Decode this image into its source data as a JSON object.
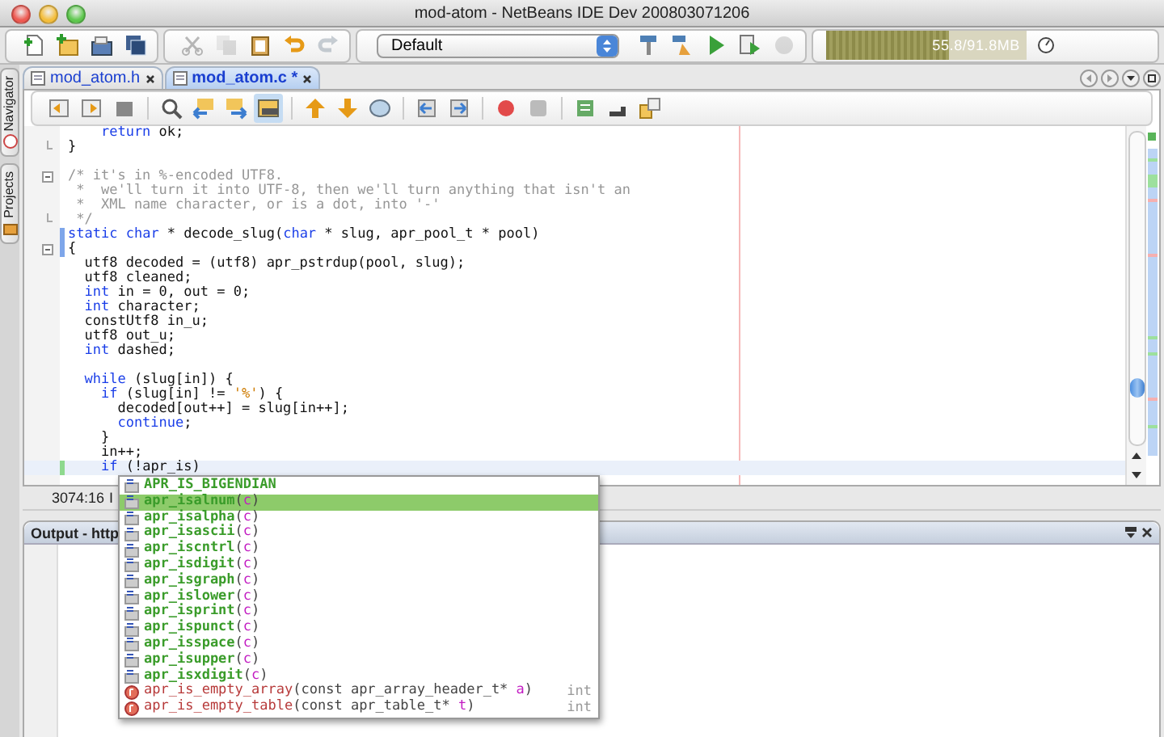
{
  "window": {
    "title": "mod-atom - NetBeans IDE Dev 200803071206"
  },
  "main_toolbar": {
    "file_buttons": [
      {
        "disabled": false
      },
      {
        "disabled": false
      },
      {
        "disabled": false
      },
      {
        "disabled": false
      }
    ],
    "edit_buttons": [
      {
        "disabled": true
      },
      {
        "disabled": true
      },
      {
        "disabled": false
      },
      {
        "disabled": false
      },
      {
        "disabled": true
      }
    ],
    "configuration": "Default",
    "run_buttons": [
      {
        "disabled": false
      },
      {
        "disabled": false
      },
      {
        "disabled": false
      },
      {
        "disabled": false
      },
      {
        "disabled": true
      }
    ],
    "memory": {
      "reading": "55.8/91.8MB",
      "level": 0.61
    }
  },
  "side_tabs": [
    {
      "label": "Navigator"
    },
    {
      "label": "Projects"
    }
  ],
  "editor_tabs": [
    {
      "label": "mod_atom.h",
      "selected": false
    },
    {
      "label": "mod_atom.c *",
      "selected": true
    }
  ],
  "editor_toolbar": [
    {
      "pressed": false
    },
    {
      "pressed": false
    },
    {
      "pressed": false
    },
    {
      "pressed": false
    },
    {
      "pressed": false
    },
    {
      "pressed": false
    },
    {
      "pressed": true
    },
    {
      "pressed": false
    },
    {
      "pressed": false
    },
    {
      "pressed": false
    },
    {
      "pressed": false
    },
    {
      "pressed": false
    },
    {
      "pressed": false
    },
    {
      "pressed": false
    },
    {
      "pressed": false
    },
    {
      "pressed": false
    },
    {
      "pressed": false
    }
  ],
  "code_lines": [
    {
      "segments": [
        {
          "text": "    return",
          "kind": "keyword"
        },
        {
          "text": " ok;",
          "kind": "plain"
        }
      ],
      "fold_start": false,
      "fold_end": false,
      "modified": false,
      "added": false,
      "current": false
    },
    {
      "segments": [
        {
          "text": "}",
          "kind": "plain"
        }
      ],
      "fold_start": false,
      "fold_end": true,
      "modified": false,
      "added": false,
      "current": false
    },
    {
      "fold_start": false,
      "fold_end": false,
      "modified": false,
      "added": false,
      "current": false
    },
    {
      "segments": [
        {
          "text": "/* it's in %-encoded UTF8.",
          "kind": "comment"
        }
      ],
      "fold_start": true,
      "fold_end": false,
      "modified": false,
      "added": false,
      "current": false
    },
    {
      "segments": [
        {
          "text": " *  we'll turn it into UTF-8, then we'll turn anything that isn't an",
          "kind": "comment"
        }
      ],
      "fold_start": false,
      "fold_end": false,
      "modified": false,
      "added": false,
      "current": false
    },
    {
      "segments": [
        {
          "text": " *  XML name character, or is a dot, into '-'",
          "kind": "comment"
        }
      ],
      "fold_start": false,
      "fold_end": false,
      "modified": false,
      "added": false,
      "current": false
    },
    {
      "segments": [
        {
          "text": " */",
          "kind": "comment"
        }
      ],
      "fold_start": false,
      "fold_end": true,
      "modified": false,
      "added": false,
      "current": false
    },
    {
      "segments": [
        {
          "text": "static",
          "kind": "keyword"
        },
        {
          "text": " char",
          "kind": "keyword"
        },
        {
          "text": " * decode_slug(",
          "kind": "plain"
        },
        {
          "text": "char",
          "kind": "keyword"
        },
        {
          "text": " * slug, apr_pool_t * pool)",
          "kind": "plain"
        }
      ],
      "fold_start": false,
      "fold_end": false,
      "modified": true,
      "added": false,
      "current": false
    },
    {
      "segments": [
        {
          "text": "{",
          "kind": "plain"
        }
      ],
      "fold_start": true,
      "fold_end": false,
      "modified": true,
      "added": false,
      "current": false
    },
    {
      "segments": [
        {
          "text": "  utf8 decoded = (utf8) apr_pstrdup(pool, slug);",
          "kind": "plain"
        }
      ],
      "fold_start": false,
      "fold_end": false,
      "modified": false,
      "added": false,
      "current": false
    },
    {
      "segments": [
        {
          "text": "  utf8 cleaned;",
          "kind": "plain"
        }
      ],
      "fold_start": false,
      "fold_end": false,
      "modified": false,
      "added": false,
      "current": false
    },
    {
      "segments": [
        {
          "text": "  int",
          "kind": "keyword"
        },
        {
          "text": " in = 0, out = 0;",
          "kind": "plain"
        }
      ],
      "fold_start": false,
      "fold_end": false,
      "modified": false,
      "added": false,
      "current": false
    },
    {
      "segments": [
        {
          "text": "  int",
          "kind": "keyword"
        },
        {
          "text": " character;",
          "kind": "plain"
        }
      ],
      "fold_start": false,
      "fold_end": false,
      "modified": false,
      "added": false,
      "current": false
    },
    {
      "segments": [
        {
          "text": "  constUtf8 in_u;",
          "kind": "plain"
        }
      ],
      "fold_start": false,
      "fold_end": false,
      "modified": false,
      "added": false,
      "current": false
    },
    {
      "segments": [
        {
          "text": "  utf8 out_u;",
          "kind": "plain"
        }
      ],
      "fold_start": false,
      "fold_end": false,
      "modified": false,
      "added": false,
      "current": false
    },
    {
      "segments": [
        {
          "text": "  int",
          "kind": "keyword"
        },
        {
          "text": " dashed;",
          "kind": "plain"
        }
      ],
      "fold_start": false,
      "fold_end": false,
      "modified": false,
      "added": false,
      "current": false
    },
    {
      "fold_start": false,
      "fold_end": false,
      "modified": false,
      "added": false,
      "current": false
    },
    {
      "segments": [
        {
          "text": "  while",
          "kind": "keyword"
        },
        {
          "text": " (slug[in]) {",
          "kind": "plain"
        }
      ],
      "fold_start": false,
      "fold_end": false,
      "modified": false,
      "added": false,
      "current": false
    },
    {
      "segments": [
        {
          "text": "    if",
          "kind": "keyword"
        },
        {
          "text": " (slug[in] != ",
          "kind": "plain"
        },
        {
          "text": "'%'",
          "kind": "string"
        },
        {
          "text": ") {",
          "kind": "plain"
        }
      ],
      "fold_start": false,
      "fold_end": false,
      "modified": false,
      "added": false,
      "current": false
    },
    {
      "segments": [
        {
          "text": "      decoded[out++] = slug[in++];",
          "kind": "plain"
        }
      ],
      "fold_start": false,
      "fold_end": false,
      "modified": false,
      "added": false,
      "current": false
    },
    {
      "segments": [
        {
          "text": "      continue",
          "kind": "keyword"
        },
        {
          "text": ";",
          "kind": "plain"
        }
      ],
      "fold_start": false,
      "fold_end": false,
      "modified": false,
      "added": false,
      "current": false
    },
    {
      "segments": [
        {
          "text": "    }",
          "kind": "plain"
        }
      ],
      "fold_start": false,
      "fold_end": false,
      "modified": false,
      "added": false,
      "current": false
    },
    {
      "segments": [
        {
          "text": "    in++;",
          "kind": "plain"
        }
      ],
      "fold_start": false,
      "fold_end": false,
      "modified": false,
      "added": false,
      "current": false
    },
    {
      "segments": [
        {
          "text": "    if",
          "kind": "keyword"
        },
        {
          "text": " (!apr_is)",
          "kind": "plain"
        }
      ],
      "fold_start": false,
      "fold_end": false,
      "modified": false,
      "added": true,
      "current": true
    }
  ],
  "status_bar": {
    "position": "3074:16",
    "mode": "I"
  },
  "output": {
    "title": "Output - http"
  },
  "completion": [
    {
      "kind": "constant",
      "selected": false,
      "parts": [
        {
          "text": "APR_IS_BIGENDIAN",
          "kind": "name"
        }
      ]
    },
    {
      "kind": "macro",
      "selected": true,
      "parts": [
        {
          "text": "apr_isalnum",
          "kind": "name"
        },
        {
          "text": "(",
          "kind": "punct"
        },
        {
          "text": "c",
          "kind": "param"
        },
        {
          "text": ")",
          "kind": "punct"
        }
      ]
    },
    {
      "kind": "macro",
      "selected": false,
      "parts": [
        {
          "text": "apr_isalpha",
          "kind": "name"
        },
        {
          "text": "(",
          "kind": "punct"
        },
        {
          "text": "c",
          "kind": "param"
        },
        {
          "text": ")",
          "kind": "punct"
        }
      ]
    },
    {
      "kind": "macro",
      "selected": false,
      "parts": [
        {
          "text": "apr_isascii",
          "kind": "name"
        },
        {
          "text": "(",
          "kind": "punct"
        },
        {
          "text": "c",
          "kind": "param"
        },
        {
          "text": ")",
          "kind": "punct"
        }
      ]
    },
    {
      "kind": "macro",
      "selected": false,
      "parts": [
        {
          "text": "apr_iscntrl",
          "kind": "name"
        },
        {
          "text": "(",
          "kind": "punct"
        },
        {
          "text": "c",
          "kind": "param"
        },
        {
          "text": ")",
          "kind": "punct"
        }
      ]
    },
    {
      "kind": "macro",
      "selected": false,
      "parts": [
        {
          "text": "apr_isdigit",
          "kind": "name"
        },
        {
          "text": "(",
          "kind": "punct"
        },
        {
          "text": "c",
          "kind": "param"
        },
        {
          "text": ")",
          "kind": "punct"
        }
      ]
    },
    {
      "kind": "macro",
      "selected": false,
      "parts": [
        {
          "text": "apr_isgraph",
          "kind": "name"
        },
        {
          "text": "(",
          "kind": "punct"
        },
        {
          "text": "c",
          "kind": "param"
        },
        {
          "text": ")",
          "kind": "punct"
        }
      ]
    },
    {
      "kind": "macro",
      "selected": false,
      "parts": [
        {
          "text": "apr_islower",
          "kind": "name"
        },
        {
          "text": "(",
          "kind": "punct"
        },
        {
          "text": "c",
          "kind": "param"
        },
        {
          "text": ")",
          "kind": "punct"
        }
      ]
    },
    {
      "kind": "macro",
      "selected": false,
      "parts": [
        {
          "text": "apr_isprint",
          "kind": "name"
        },
        {
          "text": "(",
          "kind": "punct"
        },
        {
          "text": "c",
          "kind": "param"
        },
        {
          "text": ")",
          "kind": "punct"
        }
      ]
    },
    {
      "kind": "macro",
      "selected": false,
      "parts": [
        {
          "text": "apr_ispunct",
          "kind": "name"
        },
        {
          "text": "(",
          "kind": "punct"
        },
        {
          "text": "c",
          "kind": "param"
        },
        {
          "text": ")",
          "kind": "punct"
        }
      ]
    },
    {
      "kind": "macro",
      "selected": false,
      "parts": [
        {
          "text": "apr_isspace",
          "kind": "name"
        },
        {
          "text": "(",
          "kind": "punct"
        },
        {
          "text": "c",
          "kind": "param"
        },
        {
          "text": ")",
          "kind": "punct"
        }
      ]
    },
    {
      "kind": "macro",
      "selected": false,
      "parts": [
        {
          "text": "apr_isupper",
          "kind": "name"
        },
        {
          "text": "(",
          "kind": "punct"
        },
        {
          "text": "c",
          "kind": "param"
        },
        {
          "text": ")",
          "kind": "punct"
        }
      ]
    },
    {
      "kind": "macro",
      "selected": false,
      "parts": [
        {
          "text": "apr_isxdigit",
          "kind": "name"
        },
        {
          "text": "(",
          "kind": "punct"
        },
        {
          "text": "c",
          "kind": "param"
        },
        {
          "text": ")",
          "kind": "punct"
        }
      ]
    },
    {
      "kind": "function",
      "selected": false,
      "parts": [
        {
          "text": "apr_is_empty_array",
          "kind": "fname"
        },
        {
          "text": "(const apr_array_header_t* ",
          "kind": "punct"
        },
        {
          "text": "a",
          "kind": "param"
        },
        {
          "text": ")",
          "kind": "punct"
        }
      ],
      "type": "int"
    },
    {
      "kind": "function",
      "selected": false,
      "parts": [
        {
          "text": "apr_is_empty_table",
          "kind": "fname"
        },
        {
          "text": "(const apr_table_t* ",
          "kind": "punct"
        },
        {
          "text": "t",
          "kind": "param"
        },
        {
          "text": ")",
          "kind": "punct"
        }
      ],
      "type": "int"
    }
  ]
}
